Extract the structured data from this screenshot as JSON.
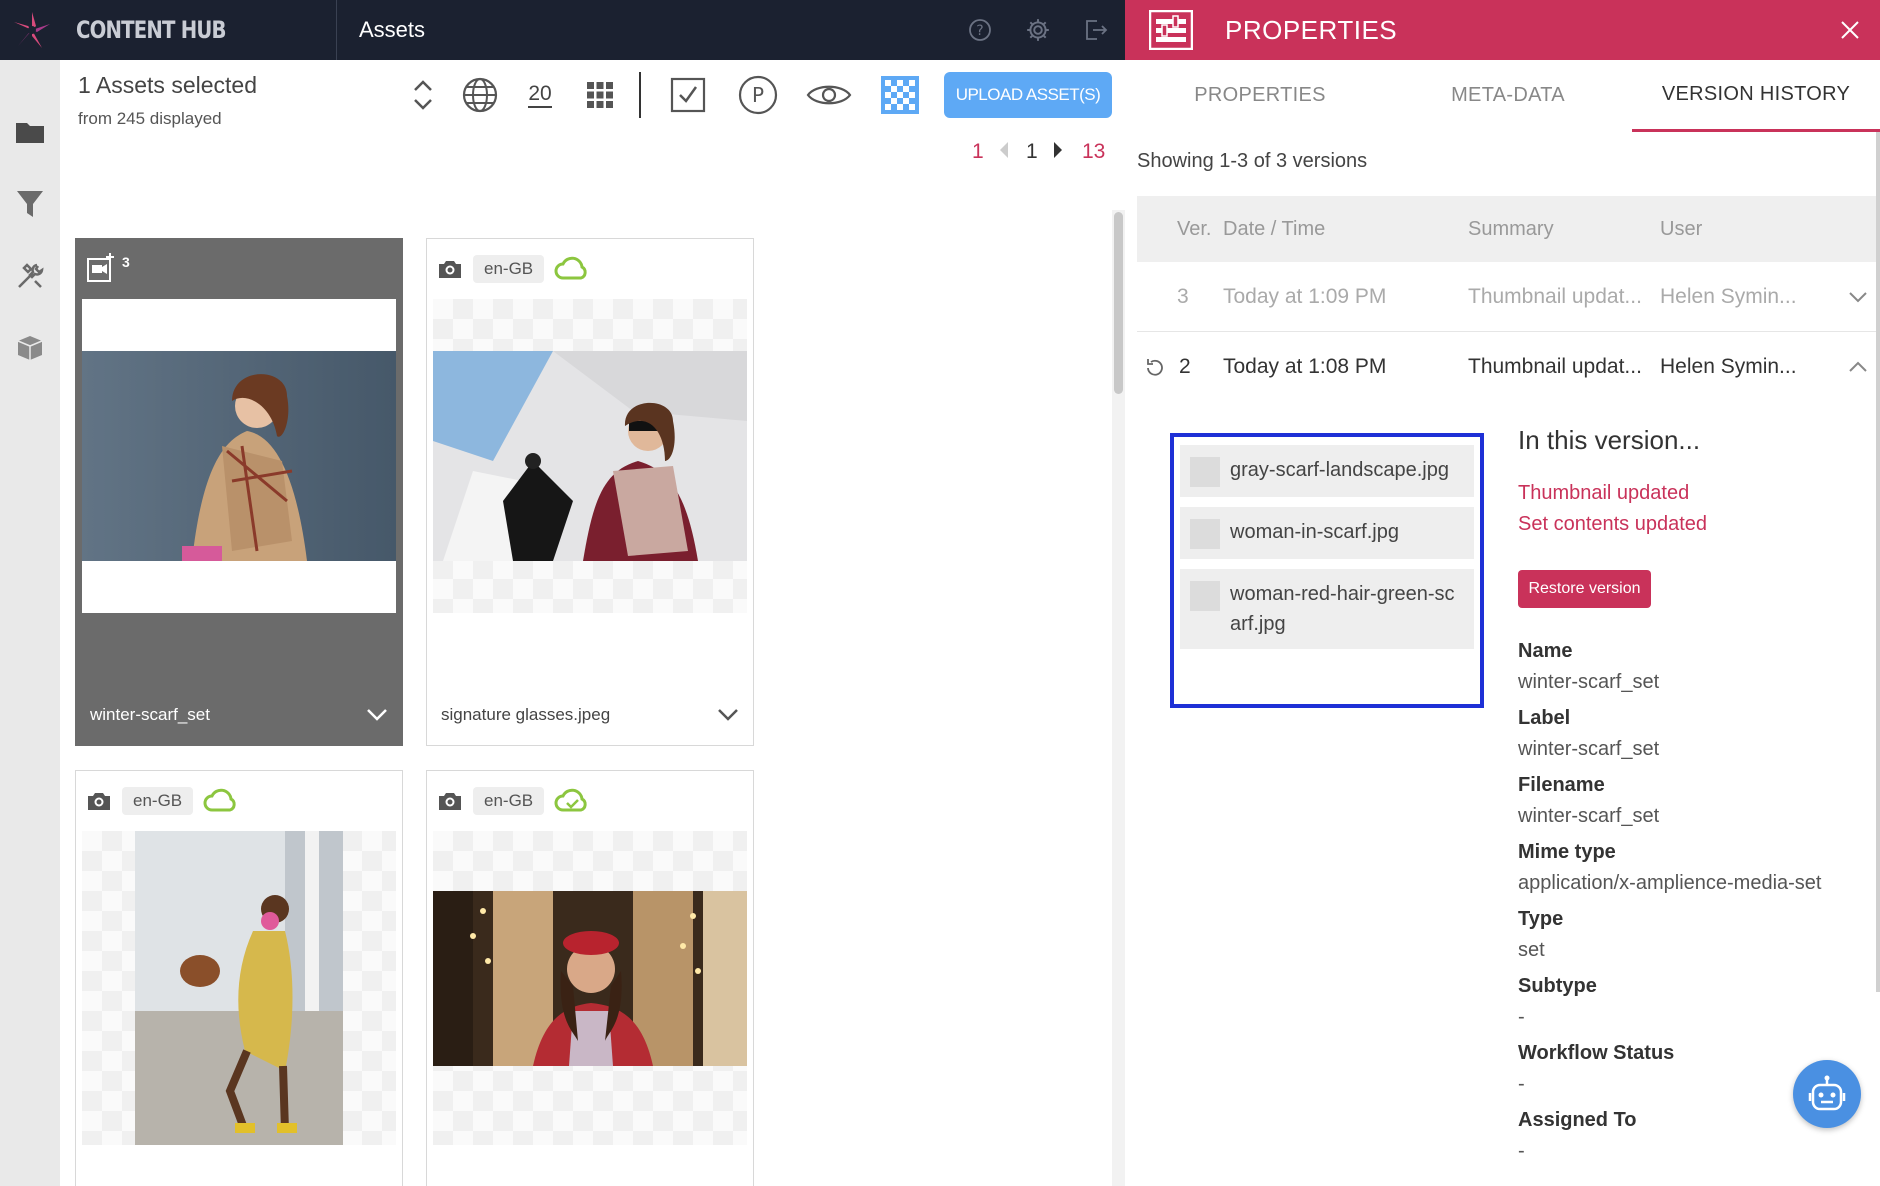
{
  "app": {
    "brand": "CONTENT HUB",
    "section_title": "Assets"
  },
  "properties_panel": {
    "header_title": "PROPERTIES",
    "tabs": [
      {
        "label": "PROPERTIES",
        "active": false
      },
      {
        "label": "META-DATA",
        "active": false
      },
      {
        "label": "VERSION HISTORY",
        "active": true
      }
    ],
    "showing": "Showing 1-3 of 3 versions",
    "columns": [
      "Ver.",
      "Date / Time",
      "Summary",
      "User"
    ],
    "versions": [
      {
        "ver": "3",
        "date": "Today at 1:09 PM",
        "summary": "Thumbnail updat...",
        "user": "Helen Symin...",
        "expanded": false
      },
      {
        "ver": "2",
        "date": "Today at 1:08 PM",
        "summary": "Thumbnail updat...",
        "user": "Helen Symin...",
        "expanded": true
      }
    ],
    "version_files": [
      "gray-scarf-landscape.jpg",
      "woman-in-scarf.jpg",
      "woman-red-hair-green-scarf.jpg"
    ],
    "in_this_version": {
      "title": "In this version...",
      "changes": [
        "Thumbnail updated",
        "Set contents updated"
      ],
      "restore_label": "Restore version"
    },
    "metadata": [
      {
        "label": "Name",
        "value": "winter-scarf_set"
      },
      {
        "label": "Label",
        "value": "winter-scarf_set"
      },
      {
        "label": "Filename",
        "value": "winter-scarf_set"
      },
      {
        "label": "Mime type",
        "value": "application/x-amplience-media-set"
      },
      {
        "label": "Type",
        "value": "set"
      },
      {
        "label": "Subtype",
        "value": "-"
      },
      {
        "label": "Workflow Status",
        "value": "-"
      },
      {
        "label": "Assigned To",
        "value": "-"
      }
    ]
  },
  "toolbar": {
    "selected_count": "1 Assets selected",
    "displayed": "from 245 displayed",
    "page_size": "20",
    "upload_label": "UPLOAD ASSET(S)",
    "pager": {
      "first": "1",
      "current": "1",
      "last": "13"
    }
  },
  "assets": [
    {
      "name": "winter-scarf_set",
      "badge_count": "3",
      "selected": true
    },
    {
      "name": "signature glasses.jpeg",
      "lang": "en-GB",
      "selected": false
    },
    {
      "name": "",
      "lang": "en-GB",
      "selected": false
    },
    {
      "name": "",
      "lang": "en-GB",
      "selected": false
    }
  ],
  "colors": {
    "brand_red": "#c9325a",
    "topbar": "#1b2130",
    "upload_blue": "#5ea9f5",
    "highlight_blue": "#1e30d6",
    "cloud_green": "#8cc63f"
  }
}
